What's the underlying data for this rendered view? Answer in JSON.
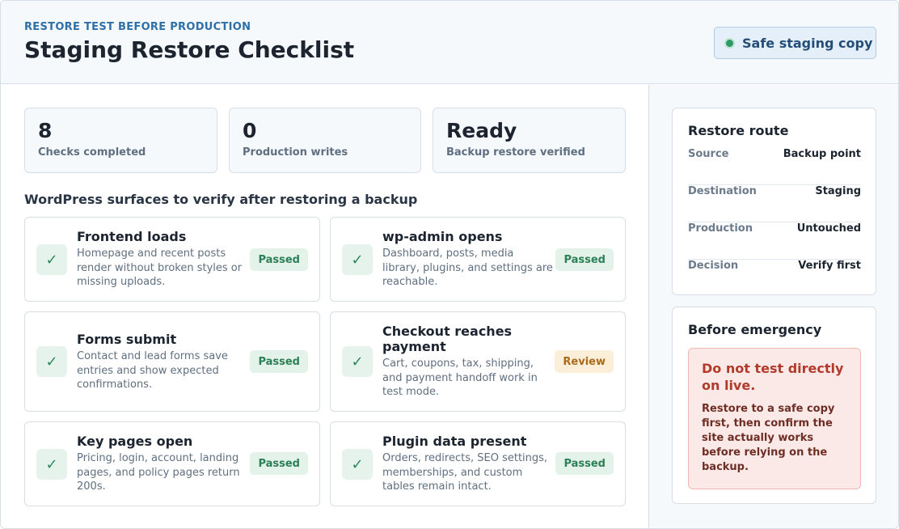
{
  "header": {
    "eyebrow": "RESTORE TEST BEFORE PRODUCTION",
    "title": "Staging Restore Checklist",
    "badge_label": "Safe staging copy"
  },
  "stats": [
    {
      "value": "8",
      "label": "Checks completed"
    },
    {
      "value": "0",
      "label": "Production writes"
    },
    {
      "value": "Ready",
      "label": "Backup restore verified"
    }
  ],
  "section_title": "WordPress surfaces to verify after restoring a backup",
  "checks": [
    {
      "title": "Frontend loads",
      "desc": "Homepage and recent posts render without broken styles or missing uploads.",
      "status": "Passed"
    },
    {
      "title": "wp-admin opens",
      "desc": "Dashboard, posts, media library, plugins, and settings are reachable.",
      "status": "Passed"
    },
    {
      "title": "Forms submit",
      "desc": "Contact and lead forms save entries and show expected confirmations.",
      "status": "Passed"
    },
    {
      "title": "Checkout reaches payment",
      "desc": "Cart, coupons, tax, shipping, and payment handoff work in test mode.",
      "status": "Review"
    },
    {
      "title": "Key pages open",
      "desc": "Pricing, login, account, landing pages, and policy pages return 200s.",
      "status": "Passed"
    },
    {
      "title": "Plugin data present",
      "desc": "Orders, redirects, SEO settings, memberships, and custom tables remain intact.",
      "status": "Passed"
    }
  ],
  "check_icon": "✓",
  "route": {
    "title": "Restore route",
    "rows": [
      {
        "key": "Source",
        "value": "Backup point"
      },
      {
        "key": "Destination",
        "value": "Staging"
      },
      {
        "key": "Production",
        "value": "Untouched"
      },
      {
        "key": "Decision",
        "value": "Verify first"
      }
    ]
  },
  "emergency": {
    "title": "Before emergency",
    "warning_title": "Do not test directly on live.",
    "warning_text": "Restore to a safe copy first, then confirm the site actually works before relying on the backup."
  }
}
